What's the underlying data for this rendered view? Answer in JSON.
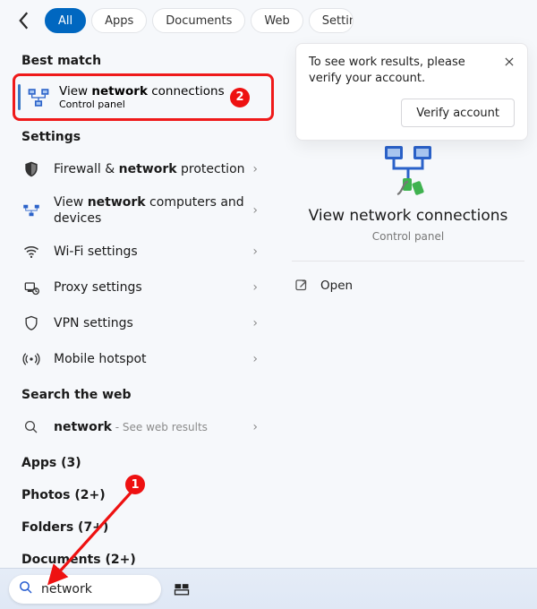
{
  "filters": {
    "tabs": [
      "All",
      "Apps",
      "Documents",
      "Web",
      "Settings"
    ],
    "active_index": 0
  },
  "sections": {
    "best_match_heading": "Best match",
    "settings_heading": "Settings",
    "search_web_heading": "Search the web"
  },
  "best_match": {
    "title_pre": "View ",
    "title_hl": "network",
    "title_post": " connections",
    "subtitle": "Control panel"
  },
  "settings_items": [
    {
      "icon": "shield",
      "title_pre": "Firewall & ",
      "title_hl": "network",
      "title_post": " protection",
      "sub": ""
    },
    {
      "icon": "netpc",
      "title_pre": "View ",
      "title_hl": "network",
      "title_post": " computers and devices",
      "sub": ""
    },
    {
      "icon": "wifi",
      "title_pre": "Wi-Fi settings",
      "title_hl": "",
      "title_post": "",
      "sub": ""
    },
    {
      "icon": "proxy",
      "title_pre": "Proxy settings",
      "title_hl": "",
      "title_post": "",
      "sub": ""
    },
    {
      "icon": "vpn",
      "title_pre": "VPN settings",
      "title_hl": "",
      "title_post": "",
      "sub": ""
    },
    {
      "icon": "hotspot",
      "title_pre": "Mobile hotspot",
      "title_hl": "",
      "title_post": "",
      "sub": ""
    }
  ],
  "web_search": {
    "query": "network",
    "suffix": " - See web results"
  },
  "more_groups": [
    {
      "label": "Apps (3)"
    },
    {
      "label": "Photos (2+)"
    },
    {
      "label": "Folders (7+)"
    },
    {
      "label": "Documents (2+)"
    }
  ],
  "preview": {
    "title": "View network connections",
    "subtitle": "Control panel",
    "open_label": "Open"
  },
  "notice": {
    "text": "To see work results, please verify your account.",
    "button": "Verify account"
  },
  "taskbar": {
    "search_value": "network"
  },
  "annotations": {
    "step1": "1",
    "step2": "2"
  }
}
